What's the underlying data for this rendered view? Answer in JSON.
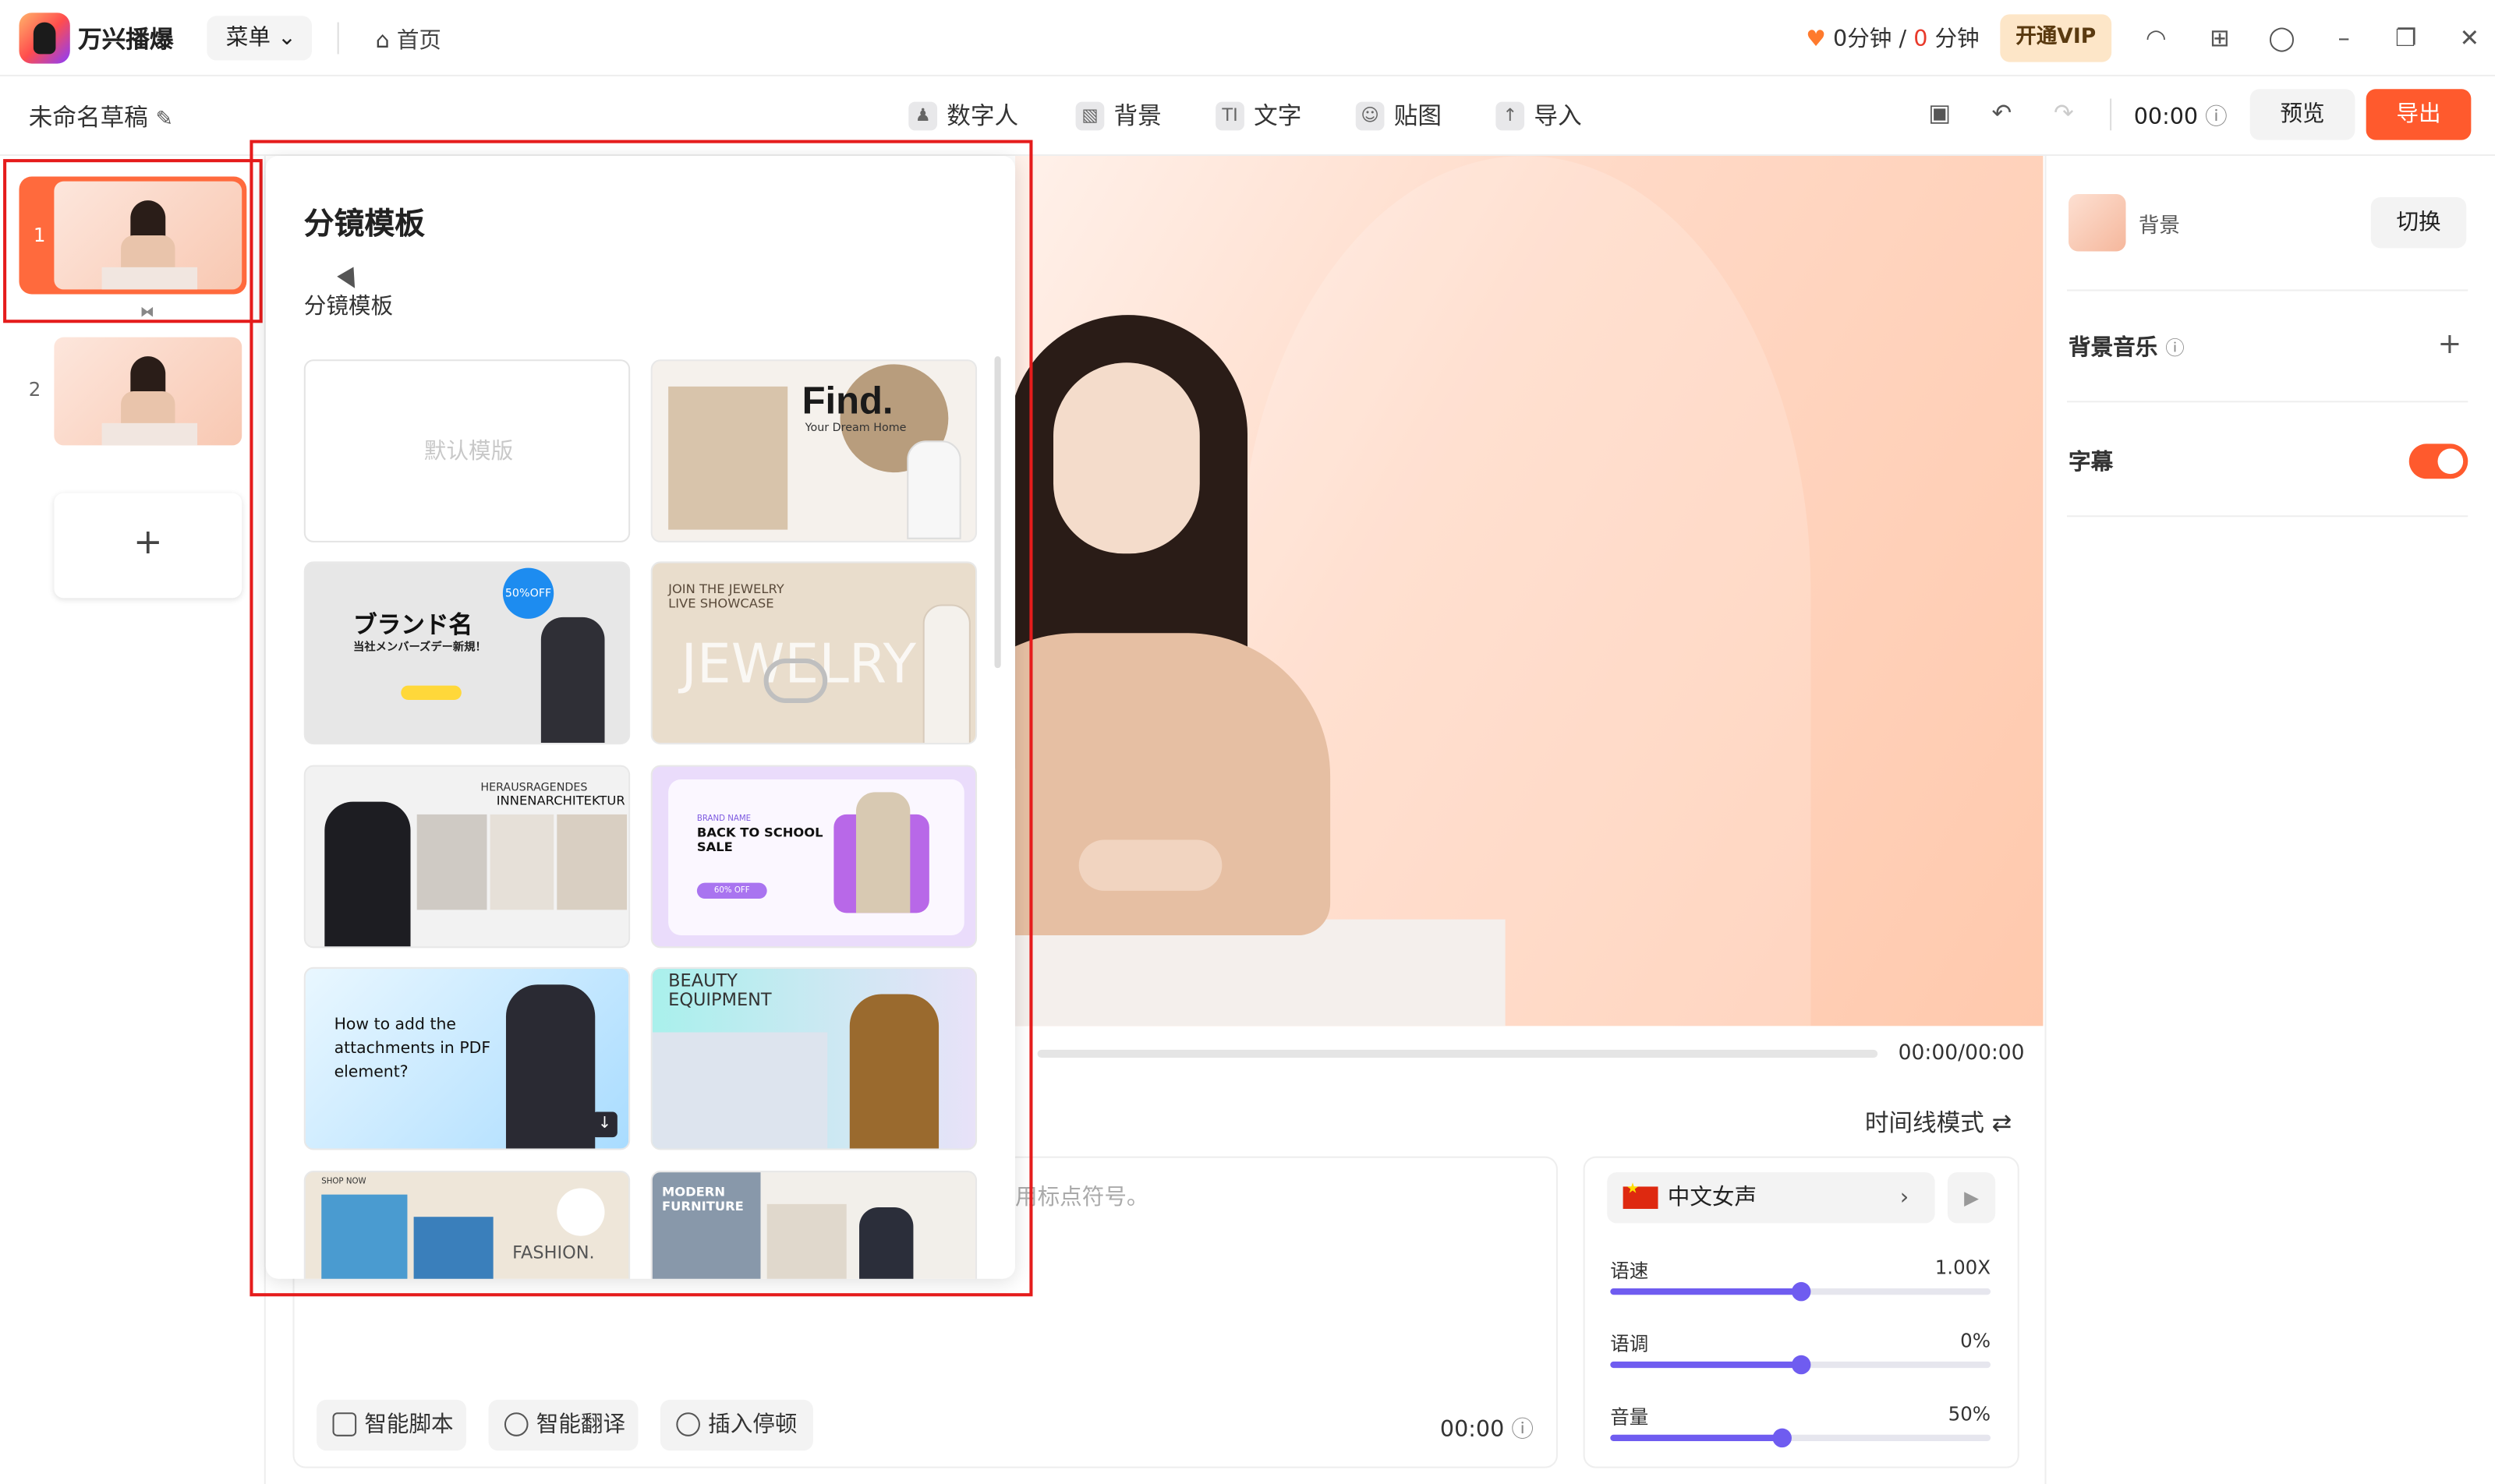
{
  "app": {
    "name": "万兴播爆",
    "menu_label": "菜单",
    "home_label": "首页"
  },
  "credits": {
    "used": "0分钟",
    "sep": "/",
    "total": "0",
    "unit": "分钟"
  },
  "vip_label": "开通VIP",
  "draft_title": "未命名草稿",
  "tools": [
    {
      "label": "数字人",
      "icon": "digital-human-icon"
    },
    {
      "label": "背景",
      "icon": "background-icon"
    },
    {
      "label": "文字",
      "icon": "text-icon"
    },
    {
      "label": "贴图",
      "icon": "sticker-icon"
    },
    {
      "label": "导入",
      "icon": "import-icon"
    }
  ],
  "toolbar_time": "00:00",
  "preview_label": "预览",
  "export_label": "导出",
  "slides": [
    {
      "num": "1"
    },
    {
      "num": "2"
    }
  ],
  "add_slide": "+",
  "template_panel": {
    "title": "分镜模板",
    "subtitle": "分镜模板",
    "default_label": "默认模版",
    "cards": [
      {
        "text": "Find.",
        "sub": "Your Dream Home"
      },
      {
        "text": "ブランド名",
        "sub": "当社メンバーズデー新規！",
        "badge": "50%OFF"
      },
      {
        "text": "JOIN THE JEWELRY LIVE SHOWCASE",
        "sub": "JEWELRY"
      },
      {
        "text": "INNENARCHITEKTUR",
        "sub": "HERAUSRAGENDES"
      },
      {
        "text": "BACK TO SCHOOL SALE",
        "sub": "BRAND NAME",
        "badge": "60% OFF"
      },
      {
        "text": "How to add the attachments in PDF element?"
      },
      {
        "text": "BEAUTY EQUIPMENT"
      },
      {
        "text": "FASHION.",
        "sub": "SHOP NOW"
      },
      {
        "text": "MODERN FURNITURE"
      }
    ]
  },
  "player": {
    "time": "00:00/00:00"
  },
  "timeline_mode": "时间线模式",
  "editor": {
    "hint": "用标点符号。",
    "buttons": [
      "智能脚本",
      "智能翻译",
      "插入停顿"
    ],
    "time": "00:00"
  },
  "voice": {
    "name": "中文女声",
    "settings": [
      {
        "label": "语速",
        "value": "1.00X",
        "pct": 0.5
      },
      {
        "label": "语调",
        "value": "0%",
        "pct": 0.5
      },
      {
        "label": "音量",
        "value": "50%",
        "pct": 0.45
      }
    ]
  },
  "right_panel": {
    "background_label": "背景",
    "switch_label": "切换",
    "music_label": "背景音乐",
    "subtitle_label": "字幕",
    "subtitle_on": true
  },
  "colors": {
    "accent": "#ff5a2d",
    "slider": "#6f5cf0",
    "highlight": "#e51c1c"
  }
}
